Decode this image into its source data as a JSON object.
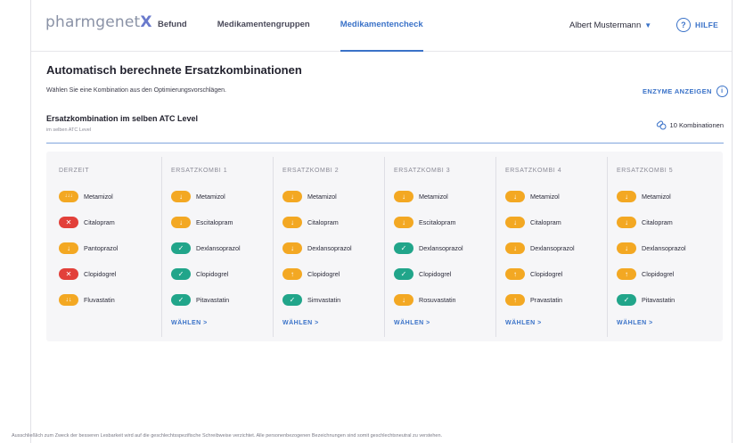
{
  "header": {
    "logo_text": "pharmgenet",
    "logo_x": "X",
    "tabs": [
      {
        "label": "Befund",
        "active": false
      },
      {
        "label": "Medikamentengruppen",
        "active": false
      },
      {
        "label": "Medikamentencheck",
        "active": true
      }
    ],
    "user_name": "Albert Mustermann",
    "help_label": "HILFE"
  },
  "page": {
    "title": "Automatisch berechnete Ersatzkombinationen",
    "subtitle": "Wählen Sie eine Kombination aus den Optimierungsvorschlägen.",
    "enzyme_label": "ENZYME ANZEIGEN"
  },
  "section": {
    "title": "Ersatzkombination im selben ATC Level",
    "subtitle": "im selben ATC Level",
    "count_label": "10 Kombinationen"
  },
  "colors": {
    "orange": "#f3a823",
    "red": "#e2403a",
    "green": "#21a58a",
    "accent": "#3a72c8"
  },
  "table": {
    "select_label": "WÄHLEN >",
    "columns": [
      {
        "header": "DERZEIT",
        "rows": [
          {
            "drug": "Metamizol",
            "status": "orange",
            "symbol": "↓↓↓"
          },
          {
            "drug": "Citalopram",
            "status": "red",
            "symbol": "✕"
          },
          {
            "drug": "Pantoprazol",
            "status": "orange",
            "symbol": "↓"
          },
          {
            "drug": "Clopidogrel",
            "status": "red",
            "symbol": "✕"
          },
          {
            "drug": "Fluvastatin",
            "status": "orange",
            "symbol": "↓↓"
          }
        ]
      },
      {
        "header": "ERSATZKOMBI 1",
        "rows": [
          {
            "drug": "Metamizol",
            "status": "orange",
            "symbol": "↓"
          },
          {
            "drug": "Escitalopram",
            "status": "orange",
            "symbol": "↓"
          },
          {
            "drug": "Dexlansoprazol",
            "status": "green",
            "symbol": "✓"
          },
          {
            "drug": "Clopidogrel",
            "status": "green",
            "symbol": "✓"
          },
          {
            "drug": "Pitavastatin",
            "status": "green",
            "symbol": "✓"
          }
        ]
      },
      {
        "header": "ERSATZKOMBI 2",
        "rows": [
          {
            "drug": "Metamizol",
            "status": "orange",
            "symbol": "↓"
          },
          {
            "drug": "Citalopram",
            "status": "orange",
            "symbol": "↓"
          },
          {
            "drug": "Dexlansoprazol",
            "status": "orange",
            "symbol": "↓"
          },
          {
            "drug": "Clopidogrel",
            "status": "orange",
            "symbol": "↑"
          },
          {
            "drug": "Simvastatin",
            "status": "green",
            "symbol": "✓"
          }
        ]
      },
      {
        "header": "ERSATZKOMBI 3",
        "rows": [
          {
            "drug": "Metamizol",
            "status": "orange",
            "symbol": "↓"
          },
          {
            "drug": "Escitalopram",
            "status": "orange",
            "symbol": "↓"
          },
          {
            "drug": "Dexlansoprazol",
            "status": "green",
            "symbol": "✓"
          },
          {
            "drug": "Clopidogrel",
            "status": "green",
            "symbol": "✓"
          },
          {
            "drug": "Rosuvastatin",
            "status": "orange",
            "symbol": "↓"
          }
        ]
      },
      {
        "header": "ERSATZKOMBI 4",
        "rows": [
          {
            "drug": "Metamizol",
            "status": "orange",
            "symbol": "↓"
          },
          {
            "drug": "Citalopram",
            "status": "orange",
            "symbol": "↓"
          },
          {
            "drug": "Dexlansoprazol",
            "status": "orange",
            "symbol": "↓"
          },
          {
            "drug": "Clopidogrel",
            "status": "orange",
            "symbol": "↑"
          },
          {
            "drug": "Pravastatin",
            "status": "orange",
            "symbol": "↑"
          }
        ]
      },
      {
        "header": "ERSATZKOMBI 5",
        "rows": [
          {
            "drug": "Metamizol",
            "status": "orange",
            "symbol": "↓"
          },
          {
            "drug": "Citalopram",
            "status": "orange",
            "symbol": "↓"
          },
          {
            "drug": "Dexlansoprazol",
            "status": "orange",
            "symbol": "↓"
          },
          {
            "drug": "Clopidogrel",
            "status": "orange",
            "symbol": "↑"
          },
          {
            "drug": "Pitavastatin",
            "status": "green",
            "symbol": "✓"
          }
        ]
      }
    ]
  },
  "footer": {
    "text": "Ausschließlich zum Zweck der besseren Lesbarkeit wird auf die geschlechtsspezifische Schreibweise verzichtet. Alle personenbezogenen Bezeichnungen sind somit geschlechtsneutral zu verstehen."
  }
}
